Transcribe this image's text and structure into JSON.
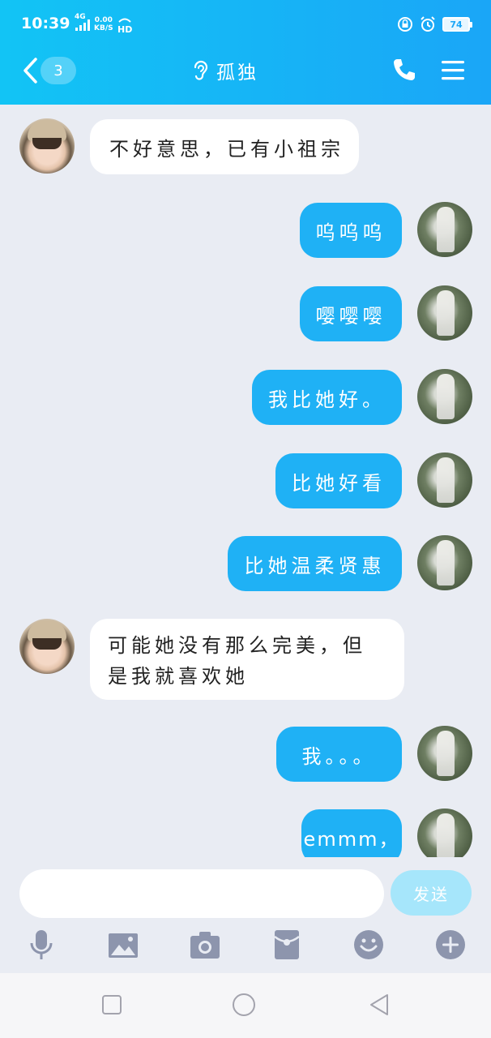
{
  "status_bar": {
    "time": "10:39",
    "network": "4G",
    "speed_value": "0.00",
    "speed_unit": "KB/S",
    "battery": "74"
  },
  "nav": {
    "unread_count": "3",
    "title": "孤独"
  },
  "messages": [
    {
      "from": "them",
      "text": "不好意思，已有小祖宗"
    },
    {
      "from": "me",
      "text": "呜呜呜"
    },
    {
      "from": "me",
      "text": "嘤嘤嘤"
    },
    {
      "from": "me",
      "text": "我比她好。"
    },
    {
      "from": "me",
      "text": "比她好看"
    },
    {
      "from": "me",
      "text": "比她温柔贤惠"
    },
    {
      "from": "them",
      "text_line1": "可能她没有那么完美，但",
      "text_line2": "是我就喜欢她"
    },
    {
      "from": "me",
      "text": "我。。。"
    },
    {
      "from": "me",
      "text": "emmm，"
    }
  ],
  "input": {
    "value": "",
    "placeholder": "",
    "send_label": "发送"
  },
  "toolbar_icons": [
    "microphone-icon",
    "image-icon",
    "camera-icon",
    "red-packet-icon",
    "emoji-icon",
    "plus-icon"
  ],
  "colors": {
    "header": "#1aa6f7",
    "my_bubble": "#1fb1f5",
    "their_bubble": "#ffffff",
    "background": "#e9ecf3",
    "send_button": "#a6e6fb"
  }
}
